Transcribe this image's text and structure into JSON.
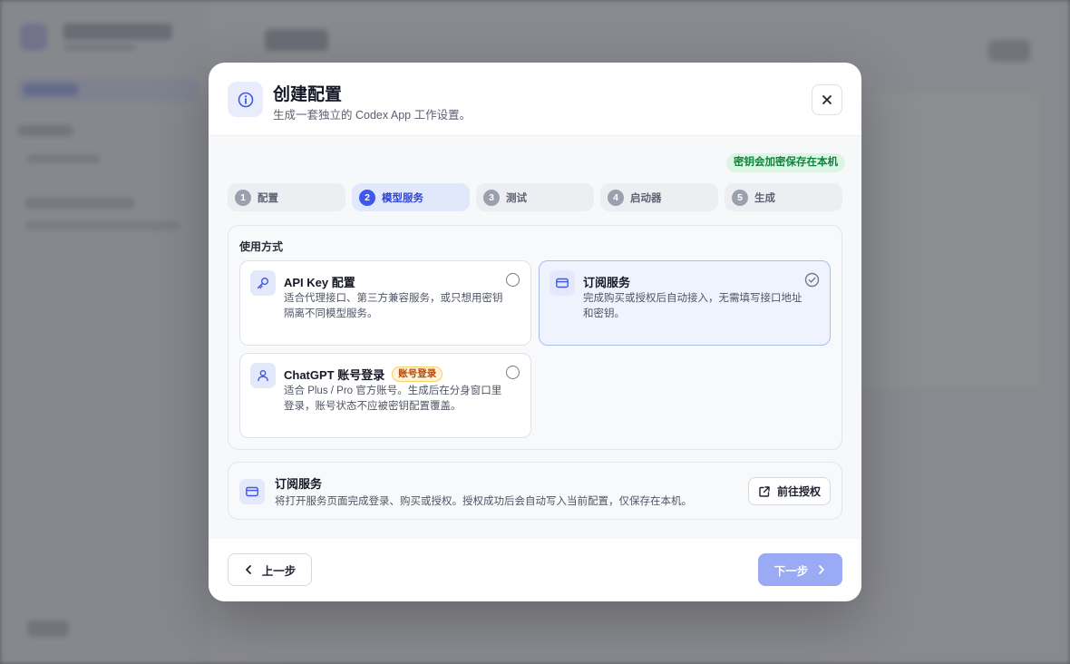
{
  "dialog": {
    "title": "创建配置",
    "subtitle": "生成一套独立的 Codex App 工作设置。",
    "secure_badge": "密钥会加密保存在本机"
  },
  "steps": [
    {
      "num": "1",
      "label": "配置"
    },
    {
      "num": "2",
      "label": "模型服务"
    },
    {
      "num": "3",
      "label": "测试"
    },
    {
      "num": "4",
      "label": "启动器"
    },
    {
      "num": "5",
      "label": "生成"
    }
  ],
  "active_step": 2,
  "usage": {
    "title": "使用方式",
    "options": [
      {
        "title": "API Key 配置",
        "desc": "适合代理接口、第三方兼容服务，或只想用密钥隔离不同模型服务。",
        "selected": false,
        "icon": "key-icon"
      },
      {
        "title": "订阅服务",
        "desc": "完成购买或授权后自动接入，无需填写接口地址和密钥。",
        "selected": true,
        "icon": "card-icon"
      },
      {
        "title": "ChatGPT 账号登录",
        "tag": "账号登录",
        "desc": "适合 Plus / Pro 官方账号。生成后在分身窗口里登录，账号状态不应被密钥配置覆盖。",
        "selected": false,
        "icon": "user-icon"
      }
    ]
  },
  "subscription_info": {
    "title": "订阅服务",
    "desc": "将打开服务页面完成登录、购买或授权。授权成功后会自动写入当前配置，仅保存在本机。",
    "button": "前往授权"
  },
  "footer": {
    "prev": "上一步",
    "next": "下一步"
  },
  "colors": {
    "accent": "#3f57ea",
    "next_button": "#9aaaf5",
    "secure_badge": "#15803d",
    "tag": "#b4470c"
  }
}
